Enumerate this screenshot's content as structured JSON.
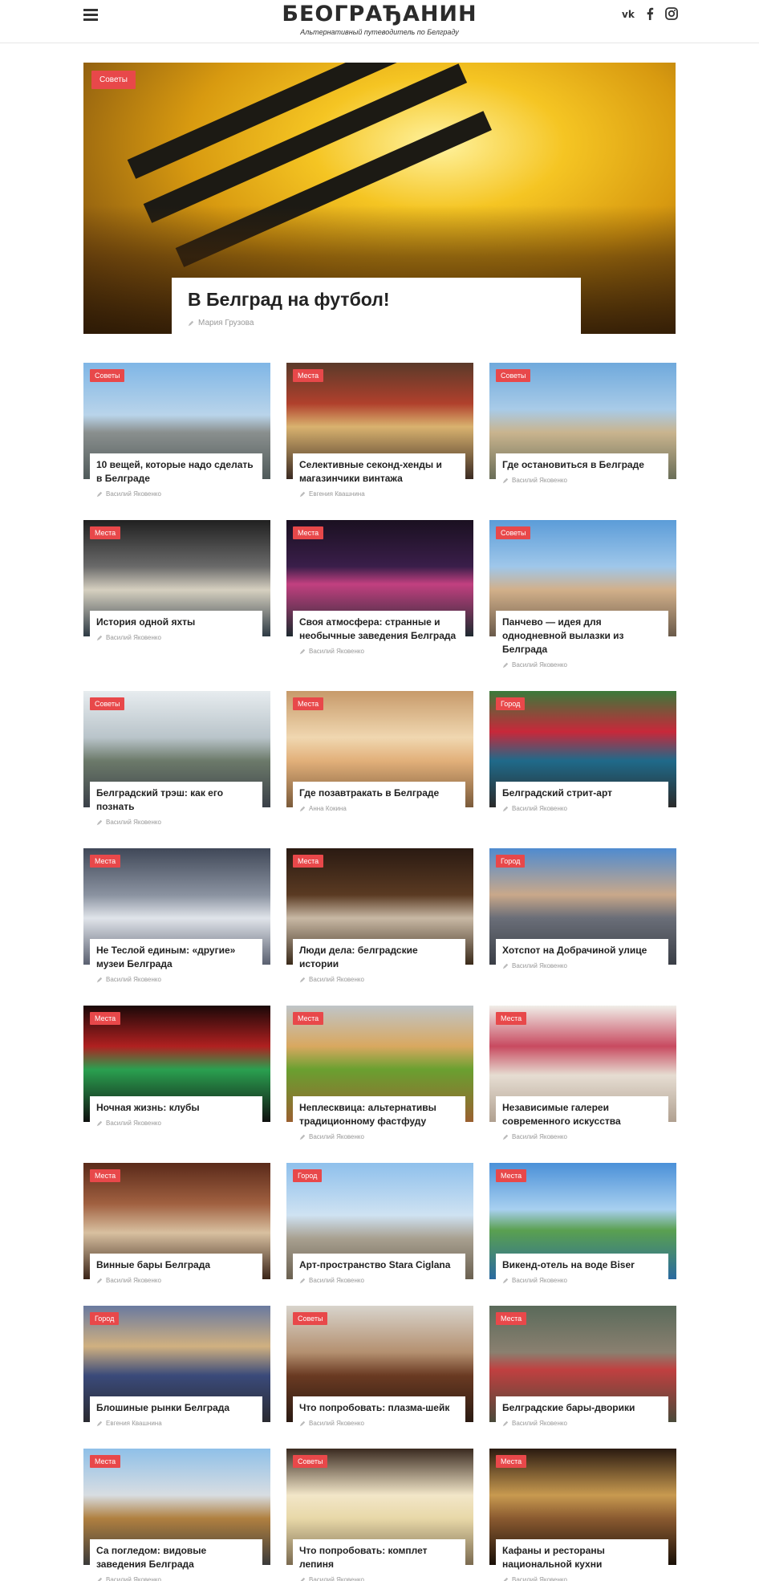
{
  "header": {
    "logo": "БЕОГРАЂАНИН",
    "tagline": "Альтернативный путеводитель по Белграду",
    "social": [
      "vk-icon",
      "facebook-icon",
      "instagram-icon"
    ]
  },
  "colors": {
    "badge": "#e8484a",
    "text": "#222222",
    "muted": "#999999"
  },
  "hero": {
    "category": "Советы",
    "title": "В Белград на футбол!",
    "author": "Мария Грузова"
  },
  "articles": [
    {
      "category": "Советы",
      "title": "10 вещей, которые надо сделать в Белграде",
      "author": "Василий Яковенко"
    },
    {
      "category": "Места",
      "title": "Селективные секонд-хенды и магазинчики винтажа",
      "author": "Евгения Квашнина"
    },
    {
      "category": "Советы",
      "title": "Где остановиться в Белграде",
      "author": "Василий Яковенко"
    },
    {
      "category": "Места",
      "title": "История одной яхты",
      "author": "Василий Яковенко"
    },
    {
      "category": "Места",
      "title": "Своя атмосфера: странные и необычные заведения Белграда",
      "author": "Василий Яковенко"
    },
    {
      "category": "Советы",
      "title": "Панчево — идея для однодневной вылазки из Белграда",
      "author": "Василий Яковенко"
    },
    {
      "category": "Советы",
      "title": "Белградский трэш: как его познать",
      "author": "Василий Яковенко"
    },
    {
      "category": "Места",
      "title": "Где позавтракать в Белграде",
      "author": "Анна Кокина"
    },
    {
      "category": "Город",
      "title": "Белградский стрит-арт",
      "author": "Василий Яковенко"
    },
    {
      "category": "Места",
      "title": "Не Теслой единым: «другие» музеи Белграда",
      "author": "Василий Яковенко"
    },
    {
      "category": "Места",
      "title": "Люди дела: белградские истории",
      "author": "Василий Яковенко"
    },
    {
      "category": "Город",
      "title": "Хотспот на Добрачиной улице",
      "author": "Василий Яковенко"
    },
    {
      "category": "Места",
      "title": "Ночная жизнь: клубы",
      "author": "Василий Яковенко"
    },
    {
      "category": "Места",
      "title": "Неплесквица: альтернативы традиционному фастфуду",
      "author": "Василий Яковенко"
    },
    {
      "category": "Места",
      "title": "Независимые галереи современного искусства",
      "author": "Василий Яковенко"
    },
    {
      "category": "Места",
      "title": "Винные бары Белграда",
      "author": "Василий Яковенко"
    },
    {
      "category": "Город",
      "title": "Арт-пространство Stara Ciglana",
      "author": "Василий Яковенко"
    },
    {
      "category": "Места",
      "title": "Викенд-отель на воде Biser",
      "author": "Василий Яковенко"
    },
    {
      "category": "Город",
      "title": "Блошиные рынки Белграда",
      "author": "Евгения Квашнина"
    },
    {
      "category": "Советы",
      "title": "Что попробовать: плазма-шейк",
      "author": "Василий Яковенко"
    },
    {
      "category": "Места",
      "title": "Белградские бары-дворики",
      "author": "Василий Яковенко"
    },
    {
      "category": "Места",
      "title": "Са погледом: видовые заведения Белграда",
      "author": "Василий Яковенко"
    },
    {
      "category": "Советы",
      "title": "Что попробовать: комплет лепиня",
      "author": "Василий Яковенко"
    },
    {
      "category": "Места",
      "title": "Кафаны и рестораны национальной кухни",
      "author": "Василий Яковенко"
    }
  ]
}
